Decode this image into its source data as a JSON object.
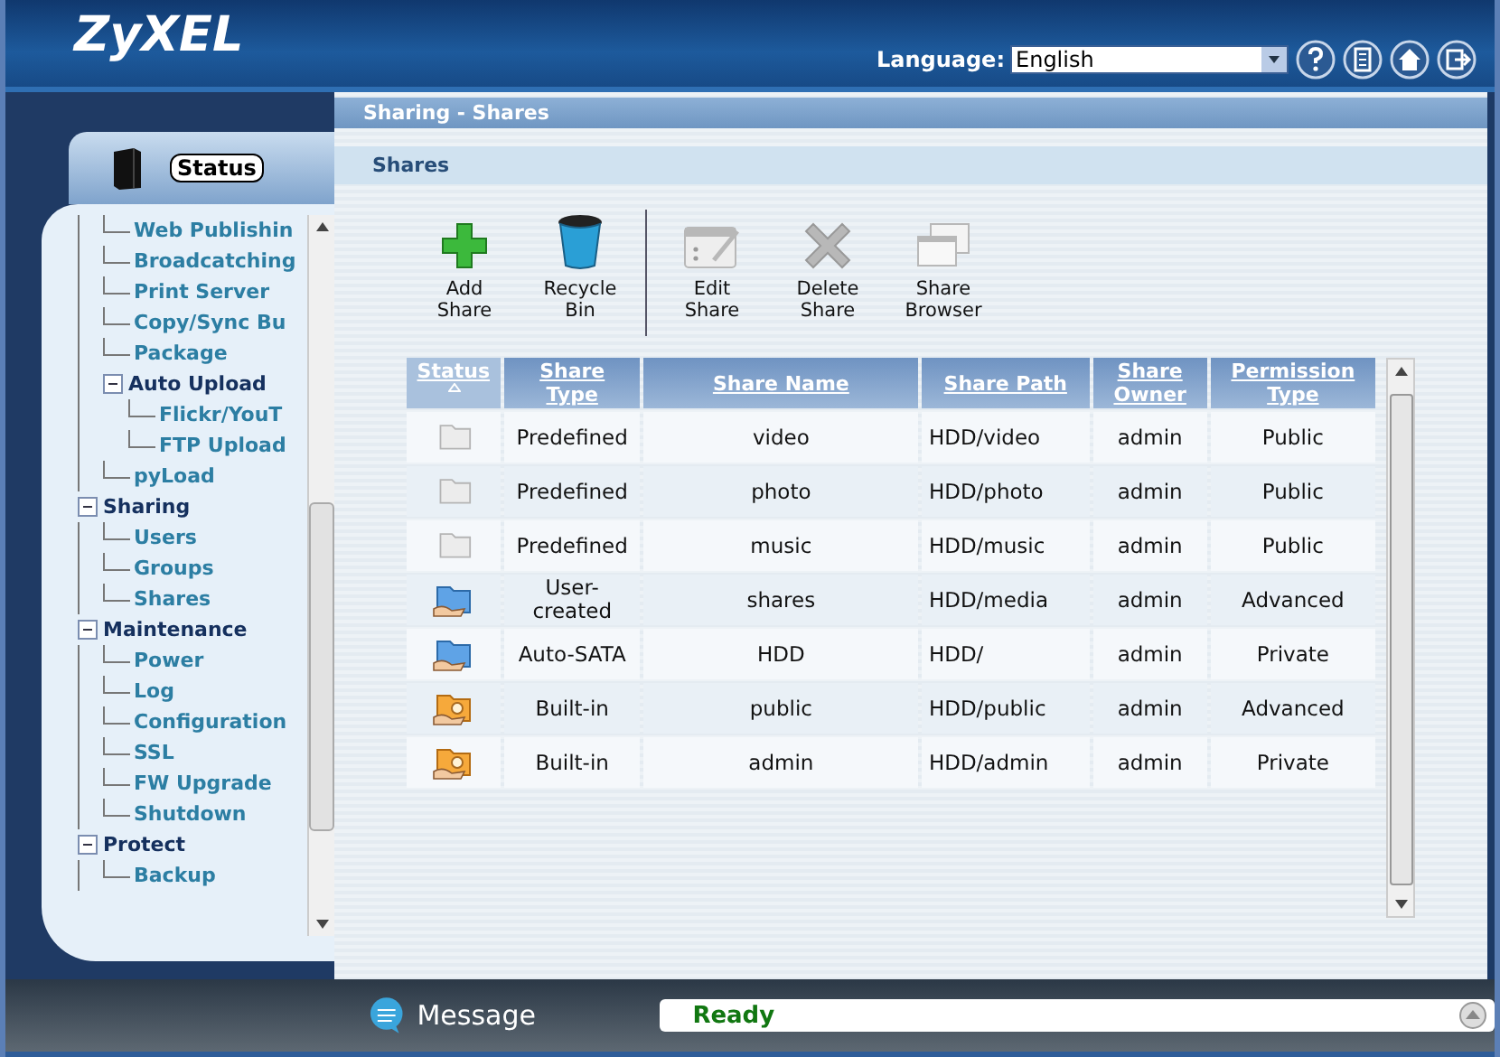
{
  "header": {
    "logo": "ZyXEL",
    "language_label": "Language:",
    "language": "English",
    "icons": [
      {
        "kind": "help"
      },
      {
        "kind": "notes"
      },
      {
        "kind": "home"
      },
      {
        "kind": "logout"
      }
    ]
  },
  "sidebar": {
    "tab": "Status",
    "tree": [
      {
        "children": [
          {
            "label": "Web Publishin"
          },
          {
            "label": "Broadcatching"
          },
          {
            "label": "Print Server"
          },
          {
            "label": "Copy/Sync Bu"
          },
          {
            "label": "Package"
          },
          {
            "label": "Auto Upload",
            "expanded": true,
            "children": [
              {
                "label": "Flickr/YouT"
              },
              {
                "label": "FTP Upload"
              }
            ]
          },
          {
            "label": "pyLoad"
          }
        ]
      },
      {
        "label": "Sharing",
        "expanded": true,
        "children": [
          {
            "label": "Users"
          },
          {
            "label": "Groups"
          },
          {
            "label": "Shares"
          }
        ]
      },
      {
        "label": "Maintenance",
        "expanded": true,
        "children": [
          {
            "label": "Power"
          },
          {
            "label": "Log"
          },
          {
            "label": "Configuration"
          },
          {
            "label": "SSL"
          },
          {
            "label": "FW Upgrade"
          },
          {
            "label": "Shutdown"
          }
        ]
      },
      {
        "label": "Protect",
        "expanded": true,
        "children": [
          {
            "label": "Backup"
          }
        ]
      }
    ]
  },
  "breadcrumb": "Sharing - Shares",
  "section_title": "Shares",
  "toolbar": [
    {
      "kind": "add",
      "label": "Add Share",
      "disabled": false
    },
    {
      "kind": "recycle",
      "label": "Recycle Bin",
      "disabled": false
    },
    {
      "kind": "edit",
      "label": "Edit Share",
      "disabled": true
    },
    {
      "kind": "delete",
      "label": "Delete Share",
      "disabled": true
    },
    {
      "kind": "browser",
      "label": "Share Browser",
      "disabled": true
    }
  ],
  "table": {
    "columns": [
      {
        "label": "Status",
        "sorted": true
      },
      {
        "label": "Share Type",
        "sorted": false
      },
      {
        "label": "Share Name",
        "sorted": false
      },
      {
        "label": "Share Path",
        "sorted": false
      },
      {
        "label": "Share Owner",
        "sorted": false
      },
      {
        "label": "Permission Type",
        "sorted": false
      }
    ],
    "rows": [
      {
        "kind": "predefined",
        "type": "Predefined",
        "name": "video",
        "path": "HDD/video",
        "owner": "admin",
        "permission": "Public"
      },
      {
        "kind": "predefined",
        "type": "Predefined",
        "name": "photo",
        "path": "HDD/photo",
        "owner": "admin",
        "permission": "Public"
      },
      {
        "kind": "predefined",
        "type": "Predefined",
        "name": "music",
        "path": "HDD/music",
        "owner": "admin",
        "permission": "Public"
      },
      {
        "kind": "shared",
        "type": "User-created",
        "name": "shares",
        "path": "HDD/media",
        "owner": "admin",
        "permission": "Advanced"
      },
      {
        "kind": "shared",
        "type": "Auto-SATA",
        "name": "HDD",
        "path": "HDD/",
        "owner": "admin",
        "permission": "Private"
      },
      {
        "kind": "builtin",
        "type": "Built-in",
        "name": "public",
        "path": "HDD/public",
        "owner": "admin",
        "permission": "Advanced"
      },
      {
        "kind": "builtin",
        "type": "Built-in",
        "name": "admin",
        "path": "HDD/admin",
        "owner": "admin",
        "permission": "Private"
      }
    ]
  },
  "message_bar": {
    "label": "Message",
    "status": "Ready"
  }
}
